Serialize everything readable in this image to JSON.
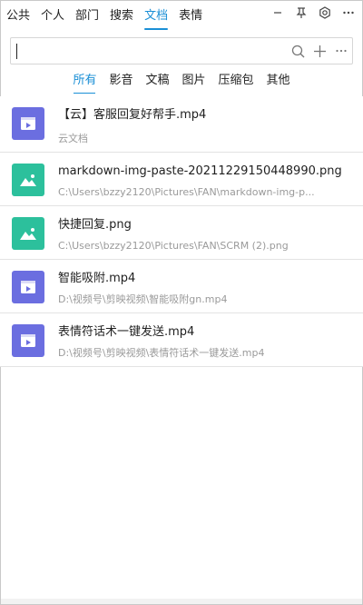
{
  "top_tabs": [
    {
      "label": "公共",
      "active": false
    },
    {
      "label": "个人",
      "active": false
    },
    {
      "label": "部门",
      "active": false
    },
    {
      "label": "搜索",
      "active": false
    },
    {
      "label": "文档",
      "active": true
    },
    {
      "label": "表情",
      "active": false
    }
  ],
  "window_icons": [
    "minimize-icon",
    "pin-icon",
    "settings-icon",
    "more-icon"
  ],
  "search": {
    "value": "",
    "placeholder": "",
    "icons": [
      "search-icon",
      "add-icon",
      "more-icon"
    ]
  },
  "filters": [
    {
      "label": "所有",
      "active": true
    },
    {
      "label": "影音",
      "active": false
    },
    {
      "label": "文稿",
      "active": false
    },
    {
      "label": "图片",
      "active": false
    },
    {
      "label": "压缩包",
      "active": false
    },
    {
      "label": "其他",
      "active": false
    }
  ],
  "files": [
    {
      "name": "【云】客服回复好帮手.mp4",
      "path": "云文档",
      "type": "video"
    },
    {
      "name": "markdown-img-paste-20211229150448990.png",
      "path": "C:\\Users\\bzzy2120\\Pictures\\FAN\\markdown-img-p...",
      "type": "image"
    },
    {
      "name": "快捷回复.png",
      "path": "C:\\Users\\bzzy2120\\Pictures\\FAN\\SCRM (2).png",
      "type": "image"
    },
    {
      "name": "智能吸附.mp4",
      "path": "D:\\视频号\\剪映视频\\智能吸附gn.mp4",
      "type": "video"
    },
    {
      "name": "表情符话术一键发送.mp4",
      "path": "D:\\视频号\\剪映视频\\表情符话术一键发送.mp4",
      "type": "video"
    }
  ],
  "colors": {
    "accent": "#1a8fd6",
    "video_icon": "#6b6ee0",
    "image_icon": "#2cc09c"
  }
}
